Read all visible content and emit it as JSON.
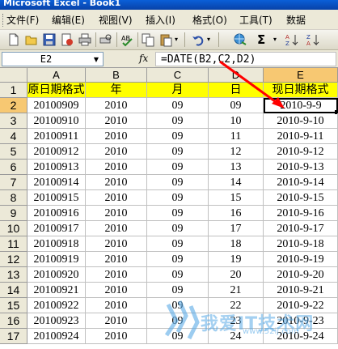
{
  "window": {
    "title": "Microsoft Excel - Book1"
  },
  "menu": {
    "items": [
      "文件(F)",
      "编辑(E)",
      "视图(V)",
      "插入(I)",
      "格式(O)",
      "工具(T)",
      "数据"
    ]
  },
  "toolbar": {
    "icons": [
      "new-icon",
      "open-icon",
      "save-icon",
      "permission-icon",
      "print-icon",
      "print-preview-icon",
      "spelling-icon",
      "copy-icon",
      "paste-icon",
      "undo-icon",
      "hyperlink-icon",
      "autosum-icon",
      "sort-icon"
    ],
    "autosum_label": "Σ"
  },
  "formula_bar": {
    "name_box": "E2",
    "fx_label": "fx",
    "formula": "=DATE(B2,C2,D2)"
  },
  "sheet": {
    "columns": [
      "A",
      "B",
      "C",
      "D",
      "E"
    ],
    "row_numbers": [
      "1",
      "2",
      "3",
      "4",
      "5",
      "6",
      "7",
      "8",
      "9",
      "10",
      "11",
      "12",
      "13",
      "14",
      "15",
      "16",
      "17"
    ],
    "header_row": [
      "原日期格式",
      "年",
      "月",
      "日",
      "现日期格式"
    ],
    "rows": [
      [
        "20100909",
        "2010",
        "09",
        "09",
        "2010-9-9"
      ],
      [
        "20100910",
        "2010",
        "09",
        "10",
        "2010-9-10"
      ],
      [
        "20100911",
        "2010",
        "09",
        "11",
        "2010-9-11"
      ],
      [
        "20100912",
        "2010",
        "09",
        "12",
        "2010-9-12"
      ],
      [
        "20100913",
        "2010",
        "09",
        "13",
        "2010-9-13"
      ],
      [
        "20100914",
        "2010",
        "09",
        "14",
        "2010-9-14"
      ],
      [
        "20100915",
        "2010",
        "09",
        "15",
        "2010-9-15"
      ],
      [
        "20100916",
        "2010",
        "09",
        "16",
        "2010-9-16"
      ],
      [
        "20100917",
        "2010",
        "09",
        "17",
        "2010-9-17"
      ],
      [
        "20100918",
        "2010",
        "09",
        "18",
        "2010-9-18"
      ],
      [
        "20100919",
        "2010",
        "09",
        "19",
        "2010-9-19"
      ],
      [
        "20100920",
        "2010",
        "09",
        "20",
        "2010-9-20"
      ],
      [
        "20100921",
        "2010",
        "09",
        "21",
        "2010-9-21"
      ],
      [
        "20100922",
        "2010",
        "09",
        "22",
        "2010-9-22"
      ],
      [
        "20100923",
        "2010",
        "09",
        "23",
        "2010-9-23"
      ],
      [
        "20100924",
        "2010",
        "09",
        "24",
        "2010-9-24"
      ]
    ],
    "selected_cell": "E2",
    "colors": {
      "header_fill": "#ffff00",
      "active_header": "#f7c872",
      "arrow": "#ff0000"
    }
  },
  "watermark": {
    "text": "我爱IT技术网",
    "url": "www.52ij.com"
  }
}
